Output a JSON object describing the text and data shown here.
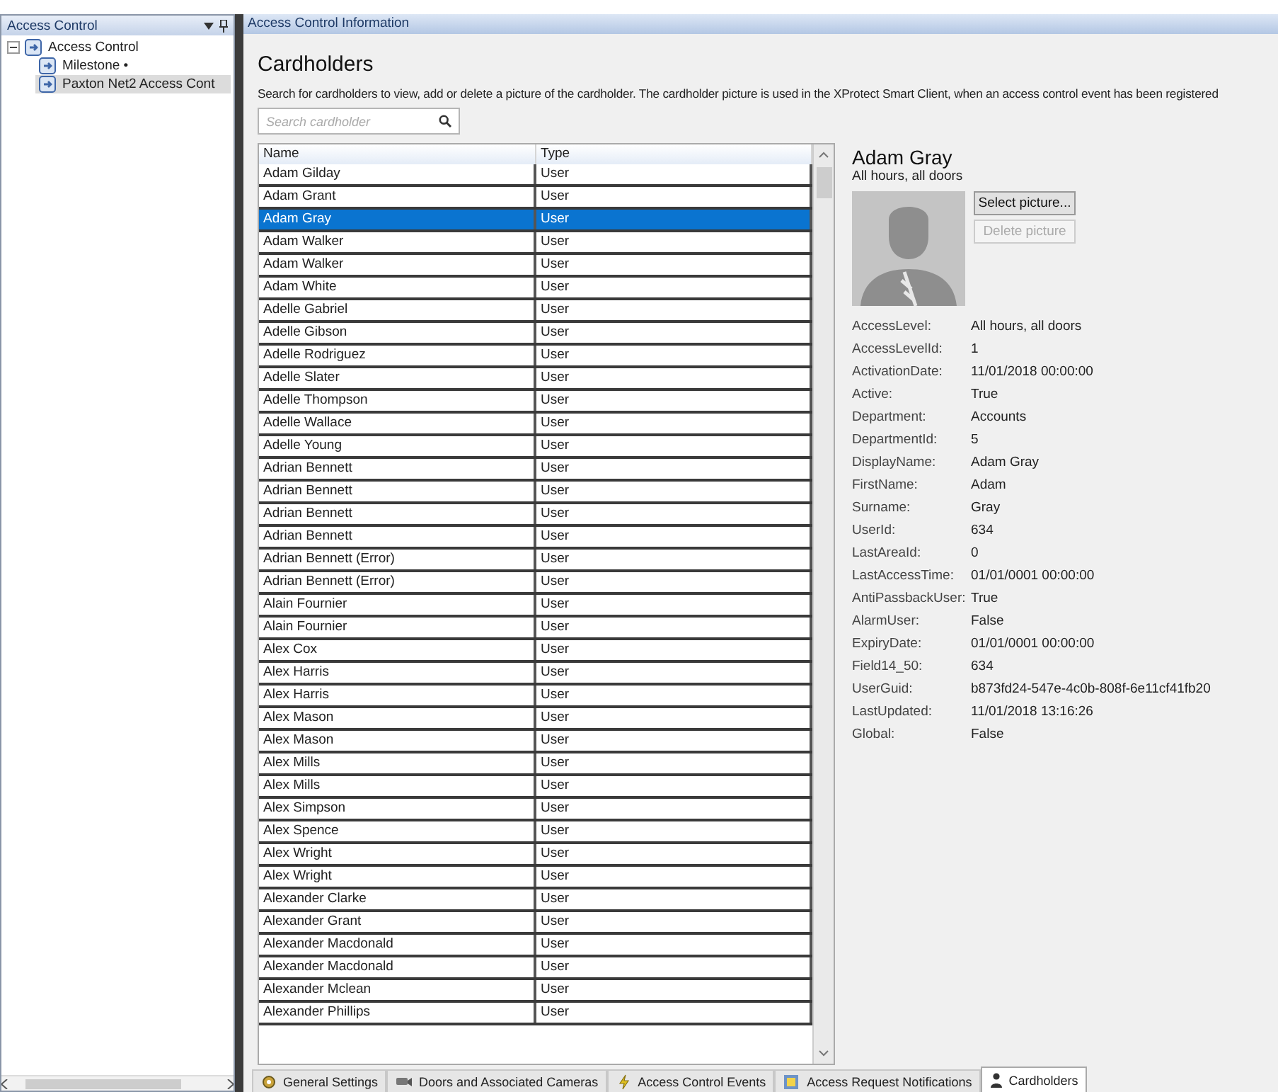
{
  "left_panel": {
    "title": "Access Control",
    "tree": [
      {
        "label": "Access Control",
        "expanded": true,
        "selected": false,
        "children": [
          {
            "label": "Milestone •",
            "selected": false
          },
          {
            "label": "Paxton Net2 Access Cont",
            "selected": true
          }
        ]
      }
    ]
  },
  "main_panel": {
    "title": "Access Control Information",
    "heading": "Cardholders",
    "description": "Search for cardholders to view, add or delete a picture of the cardholder. The cardholder picture is used in the XProtect Smart Client, when an access control event has been registered",
    "search": {
      "placeholder": "Search cardholder"
    },
    "table": {
      "columns": [
        "Name",
        "Type"
      ],
      "rows": [
        {
          "name": "Adam Gilday",
          "type": "User",
          "selected": false
        },
        {
          "name": "Adam Grant",
          "type": "User",
          "selected": false
        },
        {
          "name": "Adam Gray",
          "type": "User",
          "selected": true
        },
        {
          "name": "Adam Walker",
          "type": "User",
          "selected": false
        },
        {
          "name": "Adam Walker",
          "type": "User",
          "selected": false
        },
        {
          "name": "Adam White",
          "type": "User",
          "selected": false
        },
        {
          "name": "Adelle Gabriel",
          "type": "User",
          "selected": false
        },
        {
          "name": "Adelle Gibson",
          "type": "User",
          "selected": false
        },
        {
          "name": "Adelle Rodriguez",
          "type": "User",
          "selected": false
        },
        {
          "name": "Adelle Slater",
          "type": "User",
          "selected": false
        },
        {
          "name": "Adelle Thompson",
          "type": "User",
          "selected": false
        },
        {
          "name": "Adelle Wallace",
          "type": "User",
          "selected": false
        },
        {
          "name": "Adelle Young",
          "type": "User",
          "selected": false
        },
        {
          "name": "Adrian Bennett",
          "type": "User",
          "selected": false
        },
        {
          "name": "Adrian Bennett",
          "type": "User",
          "selected": false
        },
        {
          "name": "Adrian Bennett",
          "type": "User",
          "selected": false
        },
        {
          "name": "Adrian Bennett",
          "type": "User",
          "selected": false
        },
        {
          "name": "Adrian Bennett (Error)",
          "type": "User",
          "selected": false
        },
        {
          "name": "Adrian Bennett (Error)",
          "type": "User",
          "selected": false
        },
        {
          "name": "Alain Fournier",
          "type": "User",
          "selected": false
        },
        {
          "name": "Alain Fournier",
          "type": "User",
          "selected": false
        },
        {
          "name": "Alex Cox",
          "type": "User",
          "selected": false
        },
        {
          "name": "Alex Harris",
          "type": "User",
          "selected": false
        },
        {
          "name": "Alex Harris",
          "type": "User",
          "selected": false
        },
        {
          "name": "Alex Mason",
          "type": "User",
          "selected": false
        },
        {
          "name": "Alex Mason",
          "type": "User",
          "selected": false
        },
        {
          "name": "Alex Mills",
          "type": "User",
          "selected": false
        },
        {
          "name": "Alex Mills",
          "type": "User",
          "selected": false
        },
        {
          "name": "Alex Simpson",
          "type": "User",
          "selected": false
        },
        {
          "name": "Alex Spence",
          "type": "User",
          "selected": false
        },
        {
          "name": "Alex Wright",
          "type": "User",
          "selected": false
        },
        {
          "name": "Alex Wright",
          "type": "User",
          "selected": false
        },
        {
          "name": "Alexander Clarke",
          "type": "User",
          "selected": false
        },
        {
          "name": "Alexander Grant",
          "type": "User",
          "selected": false
        },
        {
          "name": "Alexander Macdonald",
          "type": "User",
          "selected": false
        },
        {
          "name": "Alexander Macdonald",
          "type": "User",
          "selected": false
        },
        {
          "name": "Alexander Mclean",
          "type": "User",
          "selected": false
        },
        {
          "name": "Alexander Phillips",
          "type": "User",
          "selected": false
        }
      ]
    },
    "details": {
      "name": "Adam Gray",
      "subtitle": "All hours, all doors",
      "buttons": [
        {
          "label": "Select picture...",
          "disabled": false
        },
        {
          "label": "Delete picture",
          "disabled": true
        }
      ],
      "fields": [
        {
          "label": "AccessLevel:",
          "value": "All hours, all doors"
        },
        {
          "label": "AccessLevelId:",
          "value": "1"
        },
        {
          "label": "ActivationDate:",
          "value": "11/01/2018 00:00:00"
        },
        {
          "label": "Active:",
          "value": "True"
        },
        {
          "label": "Department:",
          "value": "Accounts"
        },
        {
          "label": "DepartmentId:",
          "value": "5"
        },
        {
          "label": "DisplayName:",
          "value": "Adam Gray"
        },
        {
          "label": "FirstName:",
          "value": "Adam"
        },
        {
          "label": "Surname:",
          "value": "Gray"
        },
        {
          "label": "UserId:",
          "value": "634"
        },
        {
          "label": "LastAreaId:",
          "value": "0"
        },
        {
          "label": "LastAccessTime:",
          "value": "01/01/0001 00:00:00"
        },
        {
          "label": "AntiPassbackUser:",
          "value": "True"
        },
        {
          "label": "AlarmUser:",
          "value": "False"
        },
        {
          "label": "ExpiryDate:",
          "value": "01/01/0001 00:00:00"
        },
        {
          "label": "Field14_50:",
          "value": "634"
        },
        {
          "label": "UserGuid:",
          "value": "b873fd24-547e-4c0b-808f-6e11cf41fb20"
        },
        {
          "label": "LastUpdated:",
          "value": "11/01/2018 13:16:26"
        },
        {
          "label": "Global:",
          "value": "False"
        }
      ]
    }
  },
  "tabs": [
    {
      "label": "General Settings",
      "kind": "gear",
      "selected": false
    },
    {
      "label": "Doors and Associated Cameras",
      "kind": "camera",
      "selected": false
    },
    {
      "label": "Access Control Events",
      "kind": "bolt",
      "selected": false
    },
    {
      "label": "Access Request Notifications",
      "kind": "bell",
      "selected": false
    },
    {
      "label": "Cardholders",
      "kind": "person",
      "selected": true
    }
  ]
}
